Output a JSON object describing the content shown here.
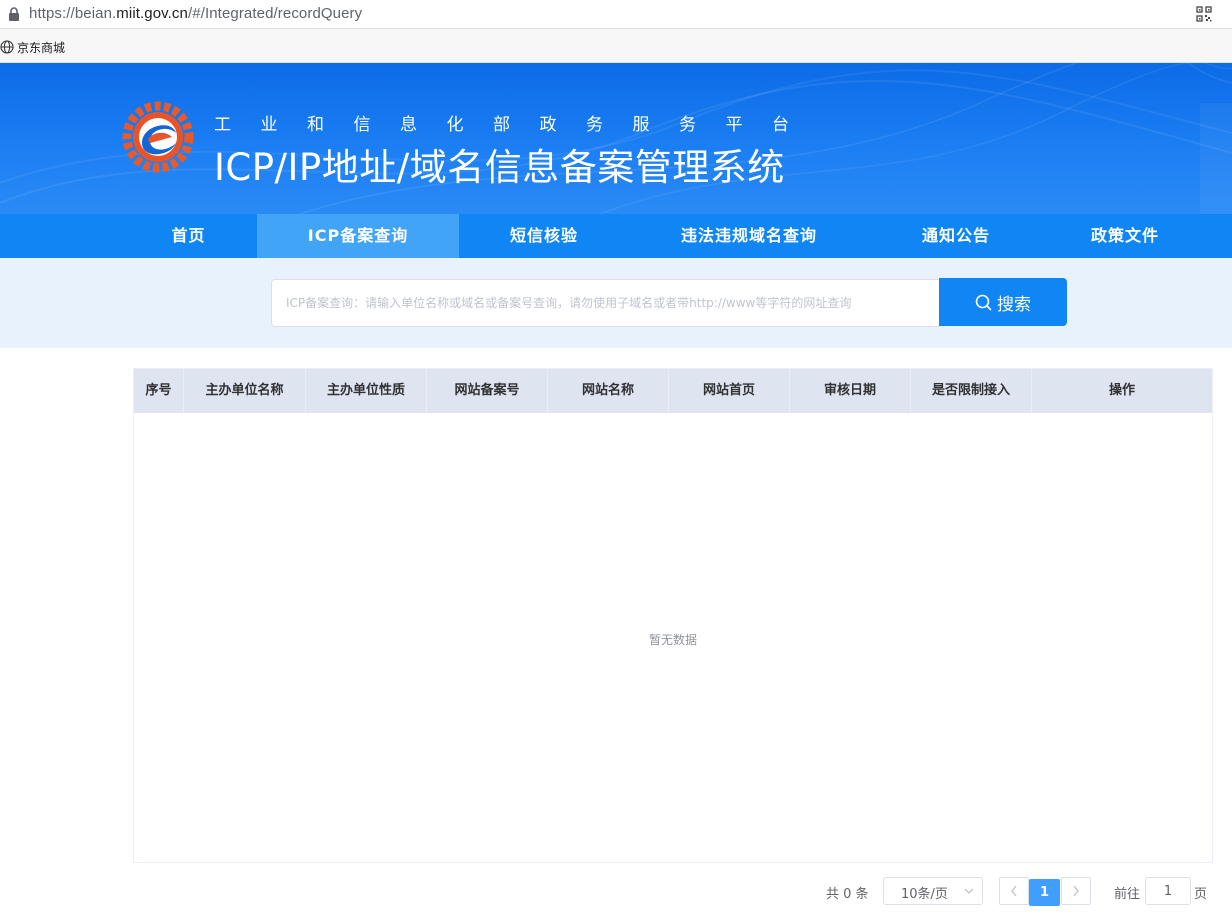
{
  "browser": {
    "url_prefix": "https://beian.",
    "url_domain": "miit.gov.cn",
    "url_path": "/#/Integrated/recordQuery",
    "bookmark_label": "京东商城"
  },
  "banner": {
    "subtitle": "工业和信息化部政务服务平台",
    "title": "ICP/IP地址/域名信息备案管理系统"
  },
  "nav": {
    "items": [
      {
        "label": "首页"
      },
      {
        "label": "ICP备案查询",
        "active": true
      },
      {
        "label": "短信核验"
      },
      {
        "label": "违法违规域名查询"
      },
      {
        "label": "通知公告"
      },
      {
        "label": "政策文件"
      }
    ]
  },
  "search": {
    "placeholder": "ICP备案查询：请输入单位名称或域名或备案号查询，请勿使用子域名或者带http://www等字符的网址查询",
    "button_label": "搜索"
  },
  "table": {
    "columns": [
      "序号",
      "主办单位名称",
      "主办单位性质",
      "网站备案号",
      "网站名称",
      "网站首页",
      "审核日期",
      "是否限制接入",
      "操作"
    ],
    "empty_text": "暂无数据"
  },
  "pagination": {
    "total_text": "共 0 条",
    "page_size": "10条/页",
    "current_page": "1",
    "goto_label": "前往",
    "goto_value": "1",
    "goto_suffix": "页"
  },
  "colors": {
    "brand_blue": "#0f86f3",
    "active_tab": "#42a4f6",
    "page_active": "#409eff"
  }
}
